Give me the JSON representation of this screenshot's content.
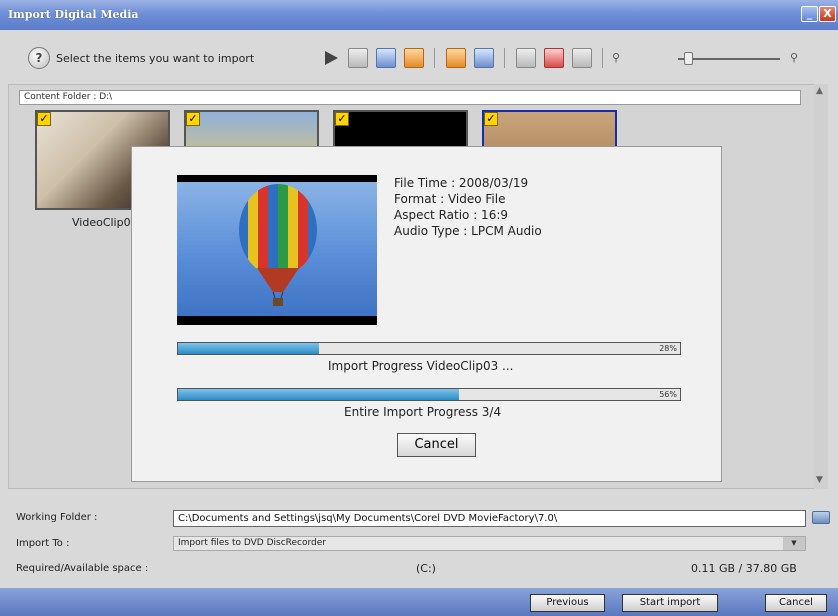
{
  "window": {
    "title": "Import Digital Media"
  },
  "toolbar": {
    "instruction": "Select the items you want to import",
    "help_label": "?"
  },
  "content": {
    "folder_label": "Content Folder : D:\\"
  },
  "thumbnails": [
    {
      "label": "VideoClip01",
      "checked": true
    },
    {
      "label": "",
      "checked": true
    },
    {
      "label": "",
      "checked": true
    },
    {
      "label": "",
      "checked": true
    }
  ],
  "dialog": {
    "file_time": "File Time : 2008/03/19",
    "format": "Format : Video File",
    "aspect_ratio": "Aspect Ratio : 16:9",
    "audio_type": "Audio Type : LPCM Audio",
    "progress1": {
      "value": 28,
      "text": "28%",
      "label": "Import Progress VideoClip03 ..."
    },
    "progress2": {
      "value": 56,
      "text": "56%",
      "label": "Entire Import Progress 3/4"
    },
    "cancel_label": "Cancel"
  },
  "form": {
    "working_folder_label": "Working Folder :",
    "working_folder_value": "C:\\Documents and Settings\\jsq\\My Documents\\Corel DVD MovieFactory\\7.0\\",
    "import_to_label": "Import To :",
    "import_to_value": "Import files to DVD DiscRecorder",
    "space_label": "Required/Available space :",
    "space_drive": "(C:)",
    "space_value": "0.11 GB / 37.80 GB"
  },
  "footer": {
    "previous_label": "Previous",
    "start_label": "Start import",
    "cancel_label": "Cancel"
  },
  "colors": {
    "titlebar": "#6f8fd6",
    "progress_fill": "#2c8cc5",
    "checkbox": "#ffd400"
  }
}
